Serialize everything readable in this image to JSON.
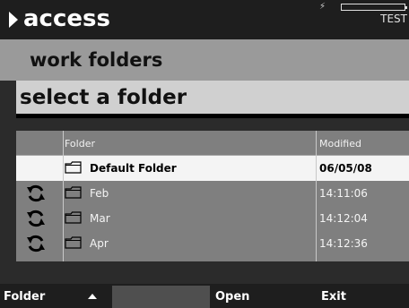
{
  "header": {
    "title": "access",
    "status_text": "TEST"
  },
  "subheader": {
    "title": "work folders"
  },
  "section": {
    "title": "select a folder"
  },
  "table": {
    "columns": {
      "folder": "Folder",
      "modified": "Modified"
    },
    "rows": [
      {
        "name": "Default Folder",
        "modified": "06/05/08",
        "selected": true,
        "sync": false
      },
      {
        "name": "Feb",
        "modified": "14:11:06",
        "selected": false,
        "sync": true
      },
      {
        "name": "Mar",
        "modified": "14:12:04",
        "selected": false,
        "sync": true
      },
      {
        "name": "Apr",
        "modified": "14:12:36",
        "selected": false,
        "sync": true
      }
    ]
  },
  "softkeys": [
    {
      "label": "Folder",
      "icon": "up-arrow-icon"
    },
    {
      "label": ""
    },
    {
      "label": "Open"
    },
    {
      "label": "Exit"
    }
  ],
  "colors": {
    "accent_dark": "#1e1e1e",
    "band_gray": "#9a9a9a",
    "row_gray": "#7f7f7f",
    "selected_row": "#f4f4f4"
  }
}
